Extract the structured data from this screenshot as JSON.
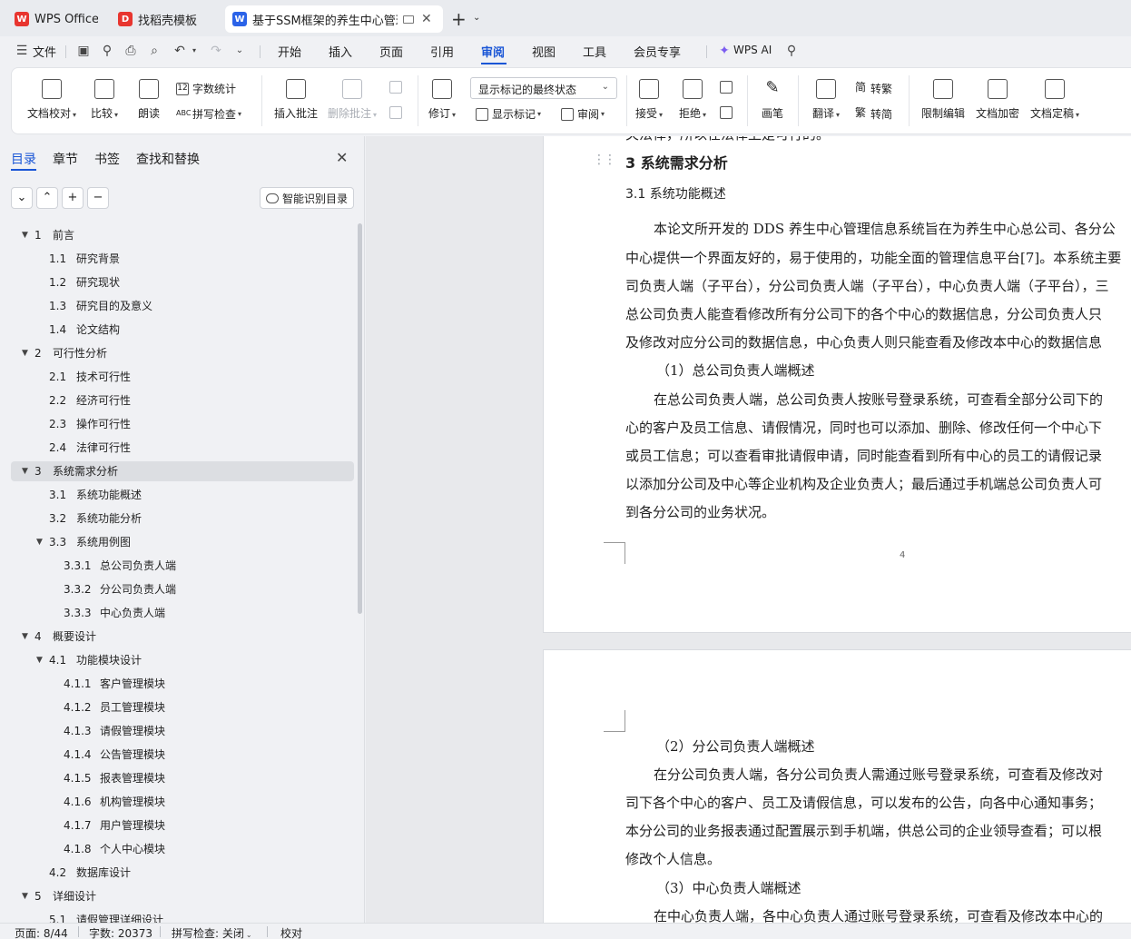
{
  "tabs": [
    {
      "label": "WPS Office",
      "icon": "wps-logo-icon",
      "color": "#e8352f"
    },
    {
      "label": "找稻壳模板",
      "icon": "docer-icon",
      "color": "#e8352f"
    },
    {
      "label": "基于SSM框架的养生中心管理",
      "icon": "word-doc-icon",
      "color": "#2b63e8"
    }
  ],
  "menu": {
    "file": "文件",
    "items": [
      "开始",
      "插入",
      "页面",
      "引用",
      "审阅",
      "视图",
      "工具",
      "会员专享"
    ],
    "active": "审阅",
    "ai": "WPS AI"
  },
  "ribbon": {
    "proofread": "文档校对",
    "compare": "比较",
    "read_aloud": "朗读",
    "word_count": "字数统计",
    "spell_check": "拼写检查",
    "insert_comment": "插入批注",
    "delete_comment": "删除批注",
    "revise": "修订",
    "markup_state": "显示标记的最终状态",
    "show_markup": "显示标记",
    "review": "审阅",
    "accept": "接受",
    "reject": "拒绝",
    "pen": "画笔",
    "translate": "翻译",
    "to_traditional": "转繁",
    "to_simplified": "转简",
    "restrict_edit": "限制编辑",
    "encrypt": "文档加密",
    "finalize": "文档定稿"
  },
  "leftpane": {
    "tabs": [
      "目录",
      "章节",
      "书签",
      "查找和替换"
    ],
    "active_tab": "目录",
    "smart_toc": "智能识别目录",
    "toc": [
      {
        "num": "1",
        "title": "前言",
        "level": 1,
        "expanded": true
      },
      {
        "num": "1.1",
        "title": "研究背景",
        "level": 2
      },
      {
        "num": "1.2",
        "title": "研究现状",
        "level": 2
      },
      {
        "num": "1.3",
        "title": "研究目的及意义",
        "level": 2
      },
      {
        "num": "1.4",
        "title": "论文结构",
        "level": 2
      },
      {
        "num": "2",
        "title": "可行性分析",
        "level": 1,
        "expanded": true
      },
      {
        "num": "2.1",
        "title": "技术可行性",
        "level": 2
      },
      {
        "num": "2.2",
        "title": "经济可行性",
        "level": 2
      },
      {
        "num": "2.3",
        "title": "操作可行性",
        "level": 2
      },
      {
        "num": "2.4",
        "title": "法律可行性",
        "level": 2
      },
      {
        "num": "3",
        "title": "系统需求分析",
        "level": 1,
        "expanded": true,
        "selected": true
      },
      {
        "num": "3.1",
        "title": "系统功能概述",
        "level": 2
      },
      {
        "num": "3.2",
        "title": "系统功能分析",
        "level": 2
      },
      {
        "num": "3.3",
        "title": "系统用例图",
        "level": 2,
        "expanded": true
      },
      {
        "num": "3.3.1",
        "title": "总公司负责人端",
        "level": 3
      },
      {
        "num": "3.3.2",
        "title": "分公司负责人端",
        "level": 3
      },
      {
        "num": "3.3.3",
        "title": "中心负责人端",
        "level": 3
      },
      {
        "num": "4",
        "title": "概要设计",
        "level": 1,
        "expanded": true
      },
      {
        "num": "4.1",
        "title": "功能模块设计",
        "level": 2,
        "expanded": true
      },
      {
        "num": "4.1.1",
        "title": "客户管理模块",
        "level": 3
      },
      {
        "num": "4.1.2",
        "title": "员工管理模块",
        "level": 3
      },
      {
        "num": "4.1.3",
        "title": "请假管理模块",
        "level": 3
      },
      {
        "num": "4.1.4",
        "title": "公告管理模块",
        "level": 3
      },
      {
        "num": "4.1.5",
        "title": "报表管理模块",
        "level": 3
      },
      {
        "num": "4.1.6",
        "title": "机构管理模块",
        "level": 3
      },
      {
        "num": "4.1.7",
        "title": "用户管理模块",
        "level": 3
      },
      {
        "num": "4.1.8",
        "title": "个人中心模块",
        "level": 3
      },
      {
        "num": "4.2",
        "title": "数据库设计",
        "level": 2
      },
      {
        "num": "5",
        "title": "详细设计",
        "level": 1,
        "expanded": true
      },
      {
        "num": "5.1",
        "title": "请假管理详细设计",
        "level": 2
      }
    ]
  },
  "document": {
    "page1": {
      "cut_line": "关法律，所以在法律上是可行的。",
      "heading": "3   系统需求分析",
      "subheading": "3.1   系统功能概述",
      "lines": [
        "本论文所开发的 DDS 养生中心管理信息系统旨在为养生中心总公司、各分公",
        "中心提供一个界面友好的，易于使用的，功能全面的管理信息平台[7]。本系统主要",
        "司负责人端（子平台），分公司负责人端（子平台），中心负责人端（子平台），三",
        "总公司负责人能查看修改所有分公司下的各个中心的数据信息，分公司负责人只",
        "及修改对应分公司的数据信息，中心负责人则只能查看及修改本中心的数据信息",
        "（1）总公司负责人端概述",
        "在总公司负责人端，总公司负责人按账号登录系统，可查看全部分公司下的",
        "心的客户及员工信息、请假情况，同时也可以添加、删除、修改任何一个中心下",
        "或员工信息；可以查看审批请假申请，同时能查看到所有中心的员工的请假记录",
        "以添加分公司及中心等企业机构及企业负责人；最后通过手机端总公司负责人可",
        "到各分公司的业务状况。"
      ],
      "page_number": "4"
    },
    "page2": {
      "lines": [
        "（2）分公司负责人端概述",
        "在分公司负责人端，各分公司负责人需通过账号登录系统，可查看及修改对",
        "司下各个中心的客户、员工及请假信息，可以发布的公告，向各中心通知事务；",
        "本分公司的业务报表通过配置展示到手机端，供总公司的企业领导查看；可以根",
        "修改个人信息。",
        "（3）中心负责人端概述",
        "在中心负责人端，各中心负责人通过账号登录系统，可查看及修改本中心的"
      ]
    }
  },
  "statusbar": {
    "page": "页面: 8/44",
    "words": "字数: 20373",
    "spell": "拼写检查: 关闭",
    "proof": "校对"
  }
}
